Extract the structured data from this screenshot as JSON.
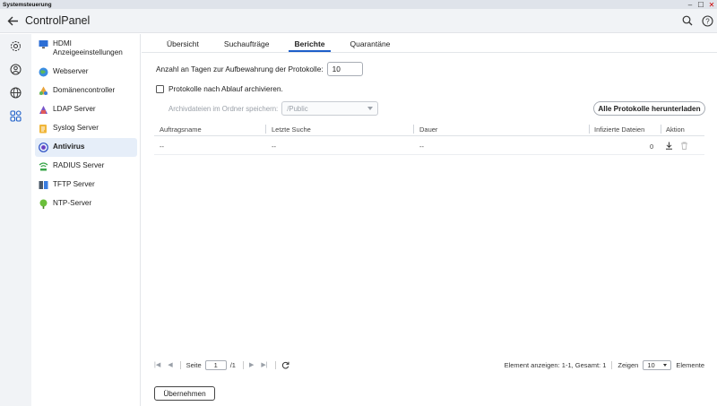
{
  "window": {
    "title": "Systemsteuerung"
  },
  "header": {
    "title": "ControlPanel"
  },
  "sidebar": {
    "items": [
      {
        "label": "HDMI Anzeigeeinstellungen",
        "icon": "monitor-icon"
      },
      {
        "label": "Webserver",
        "icon": "globe-icon"
      },
      {
        "label": "Domänencontroller",
        "icon": "domain-controller-icon"
      },
      {
        "label": "LDAP Server",
        "icon": "ldap-icon"
      },
      {
        "label": "Syslog Server",
        "icon": "syslog-icon"
      },
      {
        "label": "Antivirus",
        "icon": "antivirus-icon",
        "active": true
      },
      {
        "label": "RADIUS Server",
        "icon": "radius-icon"
      },
      {
        "label": "TFTP Server",
        "icon": "tftp-icon"
      },
      {
        "label": "NTP-Server",
        "icon": "ntp-icon"
      }
    ]
  },
  "tabs": [
    {
      "label": "Übersicht"
    },
    {
      "label": "Suchaufträge"
    },
    {
      "label": "Berichte",
      "active": true
    },
    {
      "label": "Quarantäne"
    }
  ],
  "reports": {
    "retention_label": "Anzahl an Tagen zur Aufbewahrung der Protokolle:",
    "retention_value": "10",
    "archive_label": "Protokolle nach Ablauf archivieren.",
    "archive_folder_label": "Archivdateien im Ordner speichern:",
    "archive_folder_value": "/Public",
    "download_all_label": "Alle Protokolle herunterladen"
  },
  "table": {
    "columns": [
      "Auftragsname",
      "Letzte Suche",
      "Dauer",
      "Infizierte Dateien",
      "Aktion"
    ],
    "rows": [
      {
        "name": "--",
        "last_scan": "--",
        "duration": "--",
        "infected": "0"
      }
    ]
  },
  "pager": {
    "page_label": "Seite",
    "page_value": "1",
    "page_total": "/1",
    "summary": "Element anzeigen: 1-1, Gesamt: 1",
    "show_label": "Zeigen",
    "show_value": "10",
    "items_label": "Elemente"
  },
  "apply_label": "Übernehmen",
  "colors": {
    "accent": "#1d5fc9",
    "active_bg": "#e6eef9"
  }
}
